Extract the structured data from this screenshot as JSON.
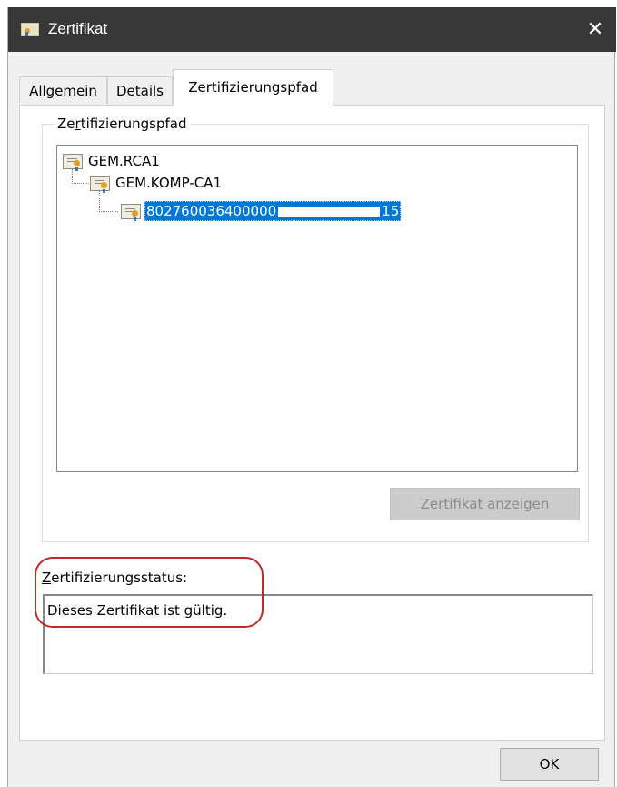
{
  "window": {
    "title": "Zertifikat",
    "close_glyph": "✕"
  },
  "tabs": [
    {
      "label": "Allgemein",
      "active": false
    },
    {
      "label": "Details",
      "active": false
    },
    {
      "label": "Zertifizierungspfad",
      "active": true
    }
  ],
  "cert_path": {
    "group_title_prefix": "Ze",
    "group_title_mnemonic": "r",
    "group_title_suffix": "tifizierungspfad",
    "nodes": [
      {
        "label": "GEM.RCA1",
        "level": 0,
        "icon": "certificate-icon"
      },
      {
        "label": "GEM.KOMP-CA1",
        "level": 1,
        "icon": "certificate-icon"
      },
      {
        "label_start": "802760036400000",
        "label_end": "15",
        "level": 2,
        "selected": true,
        "icon": "certificate-icon"
      }
    ],
    "view_button": {
      "prefix": "Zertifikat ",
      "mnemonic": "a",
      "suffix": "nzeigen",
      "enabled": false
    }
  },
  "status": {
    "label_mnemonic": "Z",
    "label_rest": "ertifizierungsstatus:",
    "text": "Dieses Zertifikat ist gültig."
  },
  "ok_button": {
    "label": "OK"
  },
  "colors": {
    "selection": "#0078d7",
    "title_bar": "#383838",
    "annotation": "#c0282a"
  }
}
